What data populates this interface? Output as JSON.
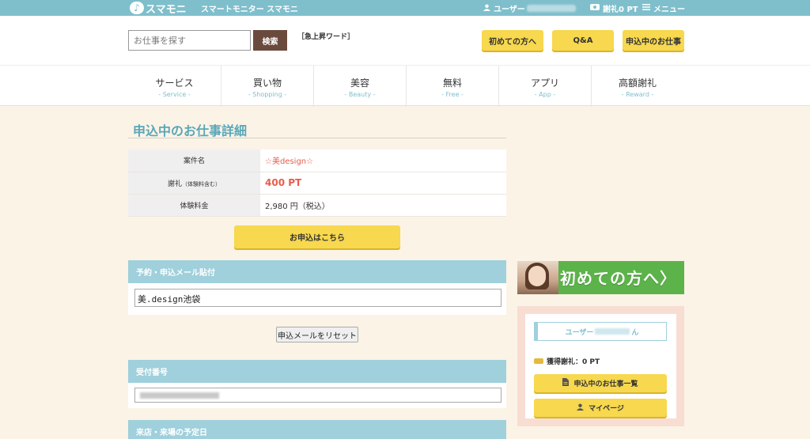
{
  "topbar": {
    "logo": "スマモニ",
    "tagline": "スマートモニター スマモニ",
    "user_prefix": "ユーザー",
    "points": "謝礼0 PT",
    "menu": "メニュー"
  },
  "header": {
    "search_placeholder": "お仕事を探す",
    "search_button": "検索",
    "trending": "［急上昇ワード］",
    "buttons": [
      "初めての方へ",
      "Q&A",
      "申込中のお仕事"
    ]
  },
  "nav": [
    {
      "ja": "サービス",
      "en": "- Service -"
    },
    {
      "ja": "買い物",
      "en": "- Shopping -"
    },
    {
      "ja": "美容",
      "en": "- Beauty -"
    },
    {
      "ja": "無料",
      "en": "- Free -"
    },
    {
      "ja": "アプリ",
      "en": "- App -"
    },
    {
      "ja": "高額謝礼",
      "en": "- Reward -"
    }
  ],
  "main": {
    "title": "申込中のお仕事詳細",
    "rows": {
      "name_label": "案件名",
      "name_value": "☆美design☆",
      "reward_label": "謝礼",
      "reward_note": "（体験料含む）",
      "reward_value": "400 PT",
      "fee_label": "体験料金",
      "fee_value": "2,980 円（税込）"
    },
    "apply_button": "お申込はこちら",
    "mail_section": "予約・申込メール貼付",
    "mail_value": "美.design池袋",
    "reset_button": "申込メールをリセット",
    "receipt_section": "受付番号",
    "visit_section": "来店・来場の予定日"
  },
  "sidebar": {
    "banner_text": "初めての方へ",
    "user_prefix": "ユーザー",
    "user_suffix": "ん",
    "earned": "獲得謝礼：0 PT",
    "jobs_button": "申込中のお仕事一覧",
    "mypage_button": "マイページ"
  },
  "colors": {
    "topbar": "#7fbfcc",
    "button_yellow": "#f7d84e",
    "section_head": "#9fd0dc",
    "accent_red": "#e85c4c"
  }
}
